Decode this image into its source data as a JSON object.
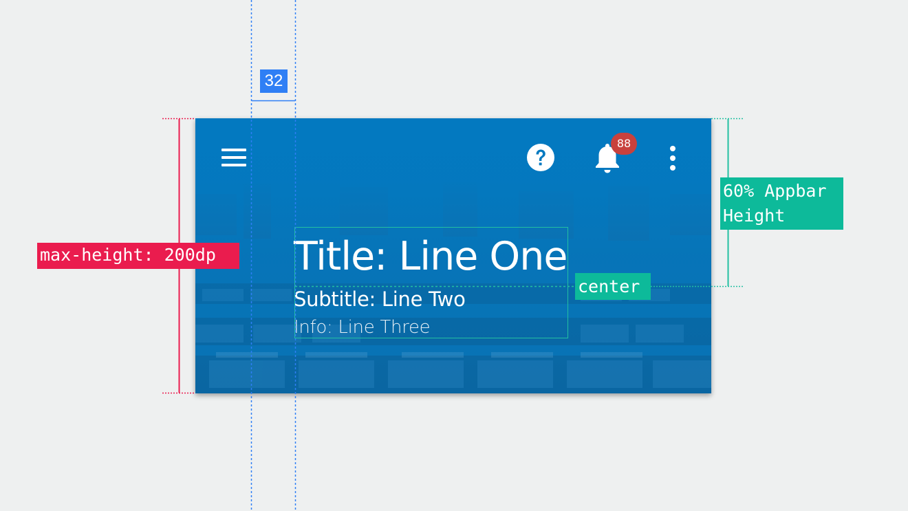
{
  "annotations": {
    "spacing_label": "32",
    "max_height_label": "max-height: 200dp",
    "center_label": "center",
    "title_height_label_line1": "60% Appbar",
    "title_height_label_line2": "Height"
  },
  "appbar": {
    "title": "Title: Line One",
    "subtitle": "Subtitle: Line Two",
    "info": "Info: Line Three",
    "notification_count": "88",
    "icons": [
      "menu-icon",
      "help-icon",
      "bell-icon",
      "more-vert-icon"
    ]
  },
  "colors": {
    "appbar": "#0379c0",
    "badge": "#c8413d",
    "annotation_red": "#ea1c4e",
    "annotation_blue": "#2f7ff5",
    "annotation_green": "#0dba9a",
    "background": "#eef0f0"
  }
}
